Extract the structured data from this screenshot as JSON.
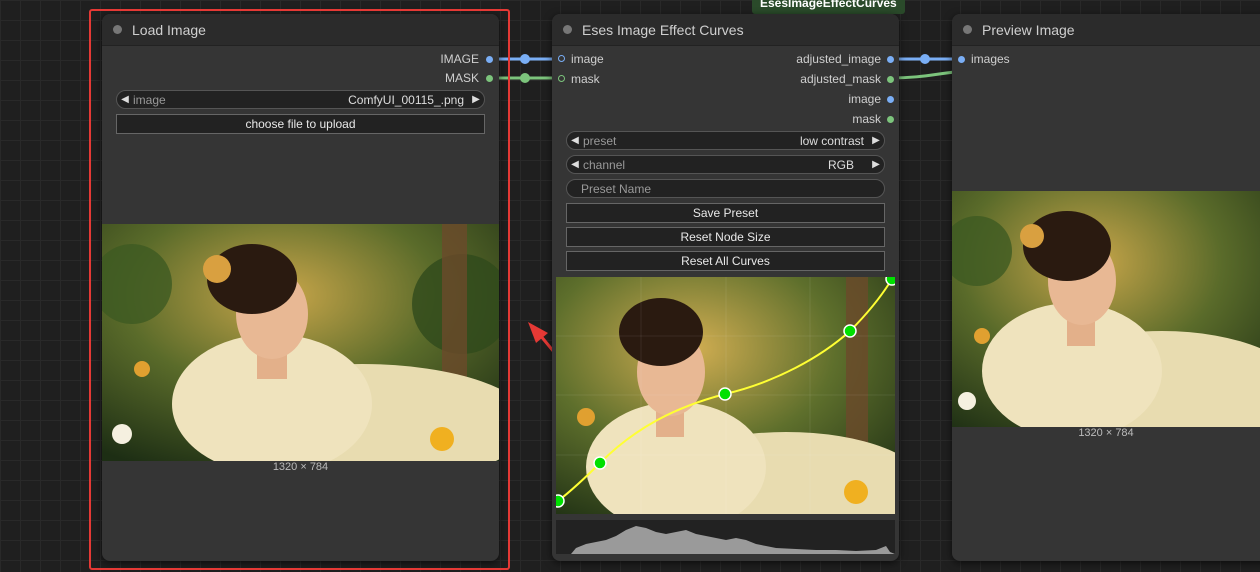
{
  "top_label": "EsesImageEffectCurves",
  "load_image": {
    "title": "Load Image",
    "outputs": [
      "IMAGE",
      "MASK"
    ],
    "image_widget": {
      "label": "image",
      "value": "ComfyUI_00115_.png"
    },
    "upload_label": "choose file to upload",
    "dimensions": "1320 × 784"
  },
  "curves": {
    "title": "Eses Image Effect Curves",
    "inputs": [
      "image",
      "mask"
    ],
    "outputs": [
      "adjusted_image",
      "adjusted_mask",
      "image",
      "mask"
    ],
    "preset_widget": {
      "label": "preset",
      "value": "low contrast"
    },
    "channel_widget": {
      "label": "channel",
      "value": "RGB"
    },
    "preset_name_placeholder": "Preset Name",
    "buttons": {
      "save_preset": "Save Preset",
      "reset_node_size": "Reset Node Size",
      "reset_all_curves": "Reset All Curves"
    }
  },
  "preview": {
    "title": "Preview Image",
    "inputs": [
      "images"
    ],
    "dimensions": "1320 × 784"
  },
  "colors": {
    "image_link": "#7aaef5",
    "mask_link": "#7cc47c",
    "selection_outline": "#e53935",
    "curve": "#ffff33",
    "curve_point": "#00e000"
  }
}
